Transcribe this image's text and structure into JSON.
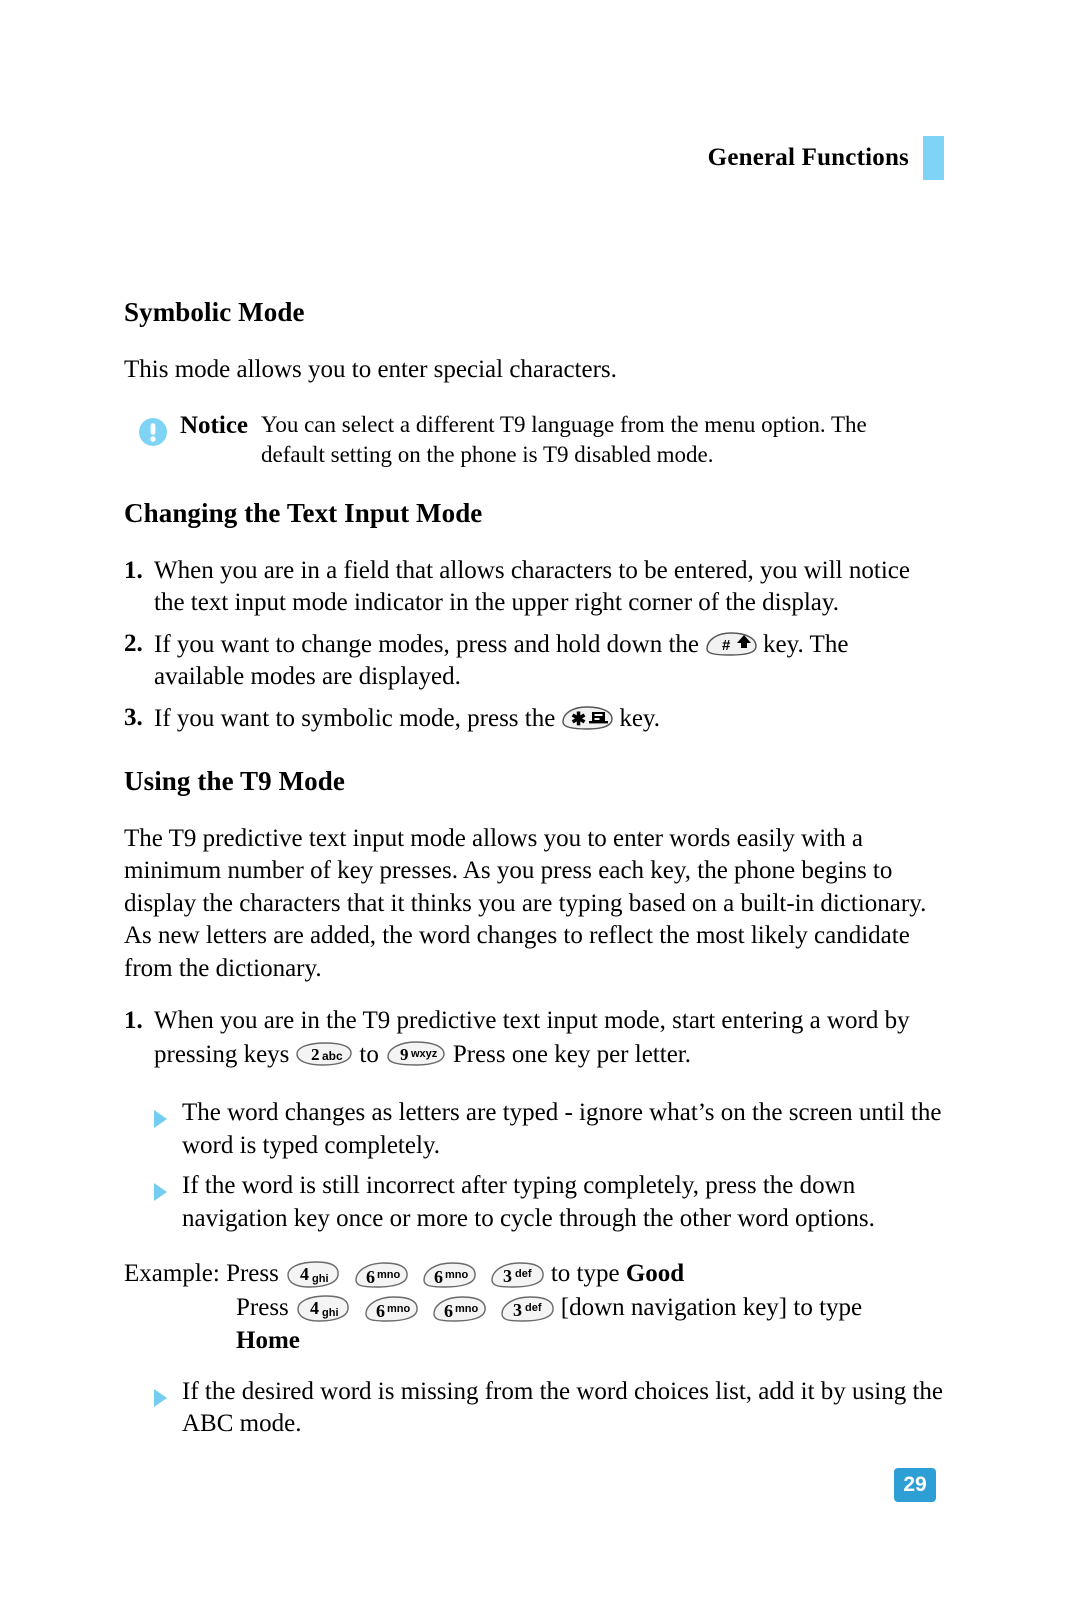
{
  "header": {
    "title": "General Functions",
    "accent_color": "#7fd4f5"
  },
  "sections": {
    "symbolic": {
      "heading": "Symbolic Mode",
      "paragraph": "This mode allows you to enter special characters."
    },
    "notice": {
      "label": "Notice",
      "line1": "You can select a different T9 language from the menu option. The",
      "line2": "default setting on the phone is T9 disabled mode.",
      "icon_color": "#7fd4f5"
    },
    "changing": {
      "heading": "Changing the Text Input Mode",
      "steps": [
        {
          "num": "1.",
          "text": "When you are in a field that allows characters to be entered, you will notice the text input mode indicator in the upper right corner of the display."
        },
        {
          "num": "2.",
          "pre": "If you want to change modes, press and hold down the",
          "key": "hash-shift-key",
          "post": "key. The available modes are displayed."
        },
        {
          "num": "3.",
          "pre": "If you want to symbolic mode, press the",
          "key": "star-symbol-key",
          "post": "key."
        }
      ]
    },
    "t9": {
      "heading": "Using the T9 Mode",
      "paragraph": "The T9 predictive text input mode allows you to enter words easily with a minimum number of key presses. As you press each key, the phone begins to display the characters that it thinks you are typing based on a built-in dictionary. As new letters are added, the word changes to reflect the most likely candidate from the dictionary.",
      "step1": {
        "num": "1.",
        "part1": "When you are in the T9 predictive text input mode, start entering a word by pressing keys",
        "key_from": {
          "digit": "2",
          "letters": "abc"
        },
        "mid": "to",
        "key_to": {
          "digit": "9",
          "letters": "wxyz"
        },
        "part2": "Press one key per letter."
      },
      "bullets": [
        "The word changes as letters are typed - ignore what’s on the screen until the word is typed completely.",
        "If the word is still incorrect after typing completely, press the down navigation key once or more to cycle through the other word options."
      ],
      "example": {
        "label": "Example:",
        "press1_label": "Press",
        "press1_keys": [
          {
            "digit": "4",
            "letters": "ghi"
          },
          {
            "digit": "6",
            "letters": "mno"
          },
          {
            "digit": "6",
            "letters": "mno"
          },
          {
            "digit": "3",
            "letters": "def"
          }
        ],
        "press1_tail_pre": "to type",
        "press1_word": "Good",
        "press2_label": "Press",
        "press2_keys": [
          {
            "digit": "4",
            "letters": "ghi"
          },
          {
            "digit": "6",
            "letters": "mno"
          },
          {
            "digit": "6",
            "letters": "mno"
          },
          {
            "digit": "3",
            "letters": "def"
          }
        ],
        "press2_tail": "[down navigation key] to type",
        "press2_word": "Home"
      },
      "last_bullet": "If the desired word is missing from the word choices list, add it by using the ABC mode."
    }
  },
  "footer": {
    "page_number": "29",
    "page_badge_color": "#2e9fd4"
  }
}
